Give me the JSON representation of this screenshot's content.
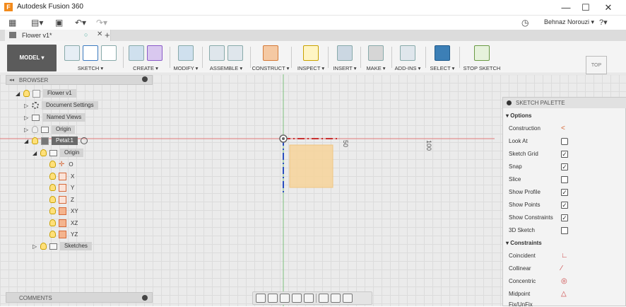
{
  "window": {
    "title": "Autodesk Fusion 360",
    "minimize": "—",
    "maximize": "☐",
    "close": "✕"
  },
  "appbar": {
    "user": "Behnaz Norouzi ▾",
    "help": "?▾"
  },
  "doc_tab": {
    "label": "Flower v1*",
    "add": "+"
  },
  "toolbar": {
    "workspace": "MODEL ▾",
    "groups": [
      "SKETCH ▾",
      "CREATE ▾",
      "MODIFY ▾",
      "ASSEMBLE ▾",
      "CONSTRUCT ▾",
      "INSPECT ▾",
      "INSERT ▾",
      "MAKE ▾",
      "ADD-INS ▾",
      "SELECT ▾",
      "STOP SKETCH"
    ]
  },
  "browser": {
    "header": "BROWSER",
    "root": "Flower v1",
    "items": [
      "Document Settings",
      "Named Views",
      "Origin",
      "Petal:1",
      "Origin",
      "O",
      "X",
      "Y",
      "Z",
      "XY",
      "XZ",
      "YZ",
      "Sketches"
    ]
  },
  "canvas": {
    "tick_50": "50",
    "tick_100": "100"
  },
  "viewcube": {
    "label": "TOP"
  },
  "palette": {
    "title": "SKETCH PALETTE",
    "options_header": "Options",
    "options": [
      {
        "label": "Construction",
        "state": "construction-icon"
      },
      {
        "label": "Look At",
        "state": "look-at-icon"
      },
      {
        "label": "Sketch Grid",
        "state": "checked"
      },
      {
        "label": "Snap",
        "state": "checked"
      },
      {
        "label": "Slice",
        "state": "unchecked"
      },
      {
        "label": "Show Profile",
        "state": "checked"
      },
      {
        "label": "Show Points",
        "state": "checked"
      },
      {
        "label": "Show Constraints",
        "state": "checked"
      },
      {
        "label": "3D Sketch",
        "state": "unchecked"
      }
    ],
    "constraints_header": "Constraints",
    "constraints": [
      "Coincident",
      "Collinear",
      "Concentric",
      "Midpoint",
      "Fix/UnFix"
    ]
  },
  "comments": {
    "label": "COMMENTS"
  }
}
